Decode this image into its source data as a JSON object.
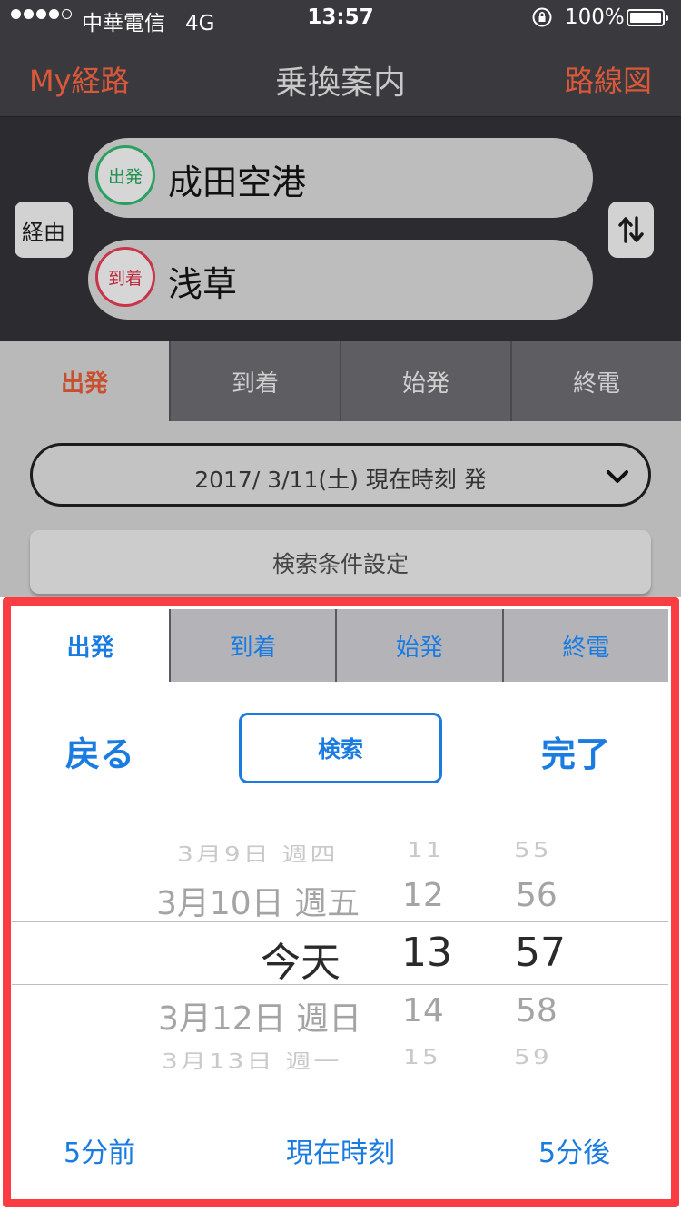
{
  "status_bar": {
    "carrier": "中華電信",
    "network": "4G",
    "time": "13:57",
    "battery": "100%",
    "signal_bars": 4,
    "signal_max": 5
  },
  "nav": {
    "left_label": "My経路",
    "title": "乗換案内",
    "right_label": "路線図"
  },
  "route": {
    "via_label": "経由",
    "from_badge": "出発",
    "from_station": "成田空港",
    "to_badge": "到着",
    "to_station": "浅草",
    "swap_icon": "swap-icon"
  },
  "mode_tabs": [
    "出発",
    "到着",
    "始発",
    "終電"
  ],
  "date_select": {
    "value": "2017/ 3/11(土) 現在時刻 発"
  },
  "conditions_button": "検索条件設定",
  "picker": {
    "tabs": [
      "出発",
      "到着",
      "始発",
      "終電"
    ],
    "back": "戻る",
    "search": "検索",
    "done": "完了",
    "rows": [
      {
        "date": "3月9日 週四",
        "hour": "11",
        "minute": "55"
      },
      {
        "date": "3月10日 週五",
        "hour": "12",
        "minute": "56"
      },
      {
        "date": "今天",
        "hour": "13",
        "minute": "57"
      },
      {
        "date": "3月12日 週日",
        "hour": "14",
        "minute": "58"
      },
      {
        "date": "3月13日 週一",
        "hour": "15",
        "minute": "59"
      }
    ],
    "footer": {
      "prev": "5分前",
      "now": "現在時刻",
      "next": "5分後"
    }
  },
  "colors": {
    "accent_orange": "#d9583a",
    "ios_blue": "#1a7be0",
    "highlight_frame": "#fa3d42",
    "departure_green": "#2aa060",
    "arrival_red": "#c8344a"
  }
}
